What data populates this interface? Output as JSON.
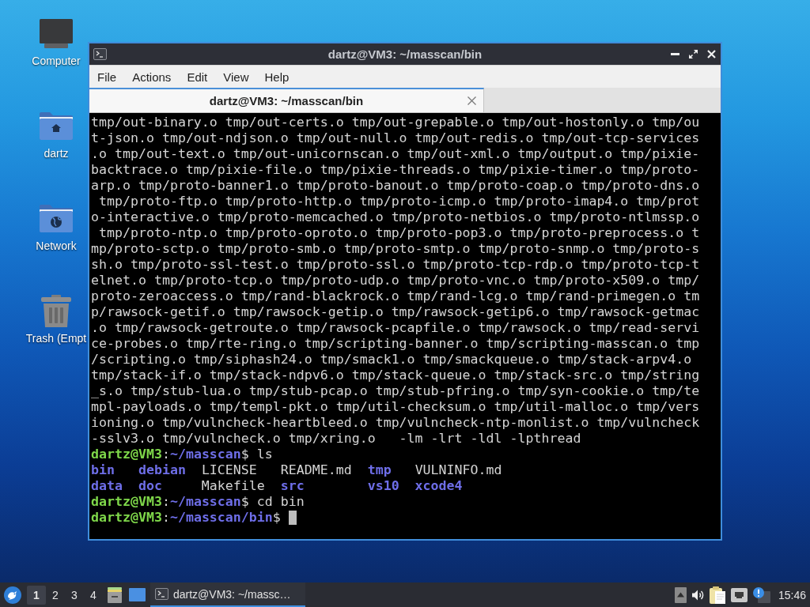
{
  "desktop_icons": [
    {
      "label": "Computer",
      "kind": "computer"
    },
    {
      "label": "dartz",
      "kind": "home"
    },
    {
      "label": "Network",
      "kind": "network"
    },
    {
      "label": "Trash (Empt",
      "kind": "trash"
    }
  ],
  "window": {
    "title": "dartz@VM3: ~/masscan/bin",
    "menu": [
      "File",
      "Actions",
      "Edit",
      "View",
      "Help"
    ],
    "tabs": [
      {
        "label": "dartz@VM3: ~/masscan/bin",
        "selected": true
      }
    ],
    "terminal": {
      "lines": [
        {
          "kind": "output",
          "text": "tmp/out-binary.o tmp/out-certs.o tmp/out-grepable.o tmp/out-hostonly.o tmp/ou"
        },
        {
          "kind": "output",
          "text": "t-json.o tmp/out-ndjson.o tmp/out-null.o tmp/out-redis.o tmp/out-tcp-services"
        },
        {
          "kind": "output",
          "text": ".o tmp/out-text.o tmp/out-unicornscan.o tmp/out-xml.o tmp/output.o tmp/pixie-"
        },
        {
          "kind": "output",
          "text": "backtrace.o tmp/pixie-file.o tmp/pixie-threads.o tmp/pixie-timer.o tmp/proto-"
        },
        {
          "kind": "output",
          "text": "arp.o tmp/proto-banner1.o tmp/proto-banout.o tmp/proto-coap.o tmp/proto-dns.o"
        },
        {
          "kind": "output",
          "text": " tmp/proto-ftp.o tmp/proto-http.o tmp/proto-icmp.o tmp/proto-imap4.o tmp/prot"
        },
        {
          "kind": "output",
          "text": "o-interactive.o tmp/proto-memcached.o tmp/proto-netbios.o tmp/proto-ntlmssp.o"
        },
        {
          "kind": "output",
          "text": " tmp/proto-ntp.o tmp/proto-oproto.o tmp/proto-pop3.o tmp/proto-preprocess.o t"
        },
        {
          "kind": "output",
          "text": "mp/proto-sctp.o tmp/proto-smb.o tmp/proto-smtp.o tmp/proto-snmp.o tmp/proto-s"
        },
        {
          "kind": "output",
          "text": "sh.o tmp/proto-ssl-test.o tmp/proto-ssl.o tmp/proto-tcp-rdp.o tmp/proto-tcp-t"
        },
        {
          "kind": "output",
          "text": "elnet.o tmp/proto-tcp.o tmp/proto-udp.o tmp/proto-vnc.o tmp/proto-x509.o tmp/"
        },
        {
          "kind": "output",
          "text": "proto-zeroaccess.o tmp/rand-blackrock.o tmp/rand-lcg.o tmp/rand-primegen.o tm"
        },
        {
          "kind": "output",
          "text": "p/rawsock-getif.o tmp/rawsock-getip.o tmp/rawsock-getip6.o tmp/rawsock-getmac"
        },
        {
          "kind": "output",
          "text": ".o tmp/rawsock-getroute.o tmp/rawsock-pcapfile.o tmp/rawsock.o tmp/read-servi"
        },
        {
          "kind": "output",
          "text": "ce-probes.o tmp/rte-ring.o tmp/scripting-banner.o tmp/scripting-masscan.o tmp"
        },
        {
          "kind": "output",
          "text": "/scripting.o tmp/siphash24.o tmp/smack1.o tmp/smackqueue.o tmp/stack-arpv4.o"
        },
        {
          "kind": "output",
          "text": "tmp/stack-if.o tmp/stack-ndpv6.o tmp/stack-queue.o tmp/stack-src.o tmp/string"
        },
        {
          "kind": "output",
          "text": "_s.o tmp/stub-lua.o tmp/stub-pcap.o tmp/stub-pfring.o tmp/syn-cookie.o tmp/te"
        },
        {
          "kind": "output",
          "text": "mpl-payloads.o tmp/templ-pkt.o tmp/util-checksum.o tmp/util-malloc.o tmp/vers"
        },
        {
          "kind": "output",
          "text": "ioning.o tmp/vulncheck-heartbleed.o tmp/vulncheck-ntp-monlist.o tmp/vulncheck"
        },
        {
          "kind": "output",
          "text": "-sslv3.o tmp/vulncheck.o tmp/xring.o   -lm -lrt -ldl -lpthread"
        },
        {
          "kind": "prompt",
          "user": "dartz@VM3",
          "separator": ":",
          "path": "~/masscan",
          "input": "$ ls",
          "cursor": false
        },
        {
          "kind": "listing",
          "entries": [
            {
              "name": "bin",
              "kind": "directory"
            },
            {
              "name": "debian",
              "kind": "directory"
            },
            {
              "name": "LICENSE",
              "kind": "file"
            },
            {
              "name": "README.md",
              "kind": "file"
            },
            {
              "name": "tmp",
              "kind": "directory"
            },
            {
              "name": "VULNINFO.md",
              "kind": "file"
            }
          ]
        },
        {
          "kind": "listing",
          "entries": [
            {
              "name": "data",
              "kind": "directory"
            },
            {
              "name": "doc",
              "kind": "directory"
            },
            {
              "name": "Makefile",
              "kind": "file"
            },
            {
              "name": "src",
              "kind": "directory"
            },
            {
              "name": "vs10",
              "kind": "directory"
            },
            {
              "name": "xcode4",
              "kind": "directory"
            }
          ]
        },
        {
          "kind": "prompt",
          "user": "dartz@VM3",
          "separator": ":",
          "path": "~/masscan",
          "input": "$ cd bin",
          "cursor": false
        },
        {
          "kind": "prompt",
          "user": "dartz@VM3",
          "separator": ":",
          "path": "~/masscan/bin",
          "input": "$",
          "cursor": true
        }
      ]
    }
  },
  "taskbar": {
    "workspaces": [
      {
        "label": "1",
        "selected": true
      },
      {
        "label": "2",
        "selected": false
      },
      {
        "label": "3",
        "selected": false
      },
      {
        "label": "4",
        "selected": false
      }
    ],
    "tasks": [
      {
        "label": "dartz@VM3: ~/massc…",
        "active": true
      }
    ],
    "clock": "15:46"
  }
}
